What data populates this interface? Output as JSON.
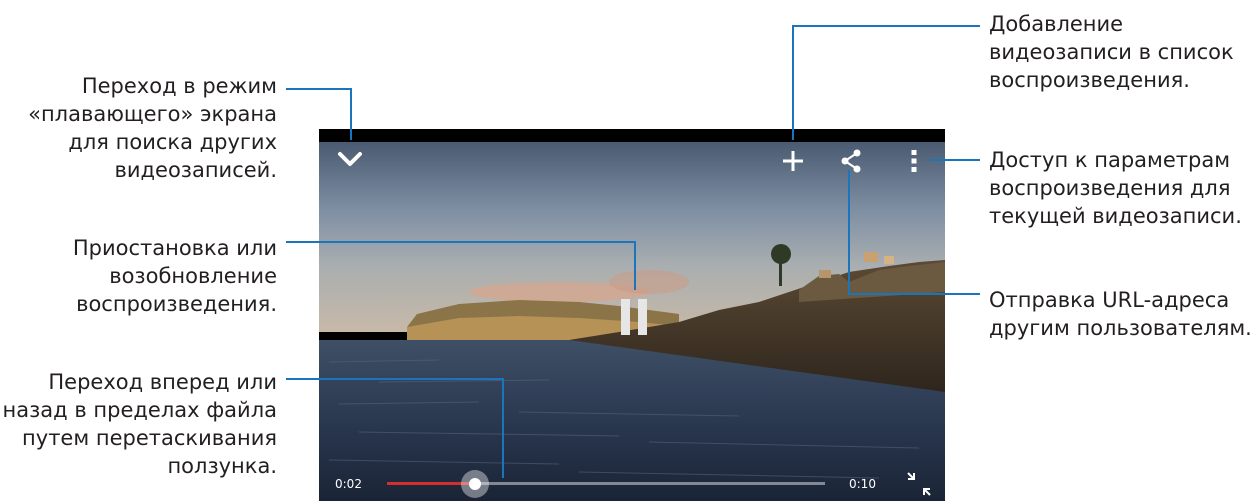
{
  "annotations": {
    "floating_mode": "Переход в режим\n«плавающего» экрана\nдля поиска других\nвидеозаписей.",
    "pause_resume": "Приостановка или\nвозобновление\nвоспроизведения.",
    "seek": "Переход вперед или\nназад в пределах файла\nпутем перетаскивания\nползунка.",
    "add_to_playlist": "Добавление\nвидеозаписи в список\nвоспроизведения.",
    "playback_options": "Доступ к параметрам\nвоспроизведения для\nтекущей видеозаписи.",
    "share_url": "Отправка URL-адреса\nдругим пользователям."
  },
  "player": {
    "elapsed_time": "0:02",
    "total_time": "0:10",
    "progress": 0.2,
    "icons": {
      "minimize": "chevron-down-icon",
      "add": "plus-icon",
      "share": "share-icon",
      "menu": "more-vert-icon",
      "pause": "pause-icon",
      "exit_fullscreen": "collapse-icon"
    }
  },
  "colors": {
    "callout_line": "#1b75bc",
    "progress_played": "#d32f2f",
    "text": "#231f20"
  }
}
